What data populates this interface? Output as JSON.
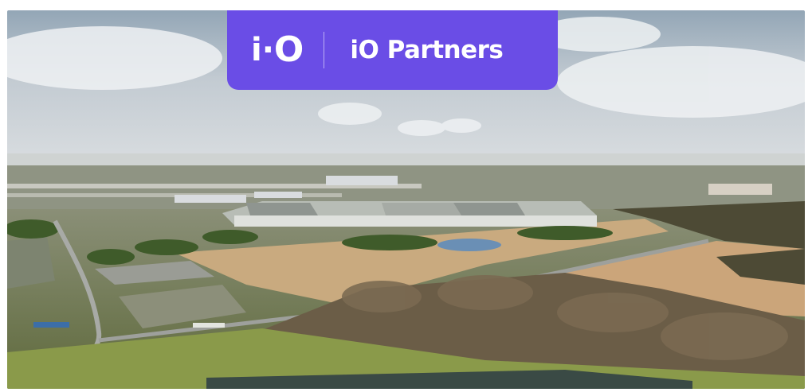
{
  "logo": {
    "mark_i": "i",
    "mark_dot": "·",
    "mark_o": "O"
  },
  "brand": {
    "name": "iO Partners"
  },
  "colors": {
    "banner": "#6a4de6",
    "sky": "#b9c3cc",
    "field": "#c9aa7f",
    "grass": "#6f7d43"
  }
}
